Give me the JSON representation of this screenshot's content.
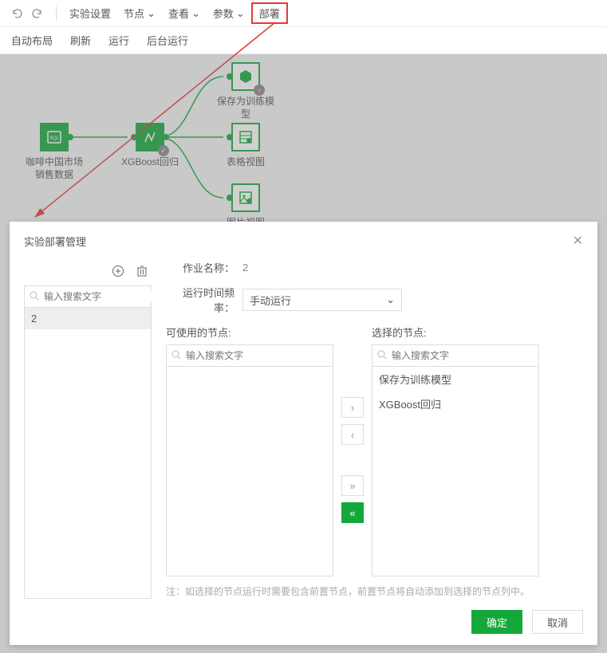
{
  "topbar": {
    "menu_exp_settings": "实验设置",
    "menu_nodes": "节点",
    "menu_view": "查看",
    "menu_params": "参数",
    "menu_deploy": "部署"
  },
  "subbar": {
    "auto_layout": "自动布局",
    "refresh": "刷新",
    "run": "运行",
    "run_bg": "后台运行"
  },
  "nodes": {
    "data_source": "咖啡中国市场销售数据",
    "model": "XGBoost回归",
    "save_model": "保存为训练模型",
    "table_view": "表格视图",
    "image_view": "图片视图"
  },
  "dialog": {
    "title": "实验部署管理",
    "job_name_label": "作业名称：",
    "job_name_value": "2",
    "freq_label": "运行时间频率：",
    "freq_value": "手动运行",
    "search_placeholder": "输入搜索文字",
    "left_list": [
      "2"
    ],
    "available_label": "可使用的节点:",
    "selected_label": "选择的节点:",
    "selected_items": [
      "保存为训练模型",
      "XGBoost回归"
    ],
    "note": "注：如选择的节点运行时需要包含前置节点，前置节点将自动添加到选择的节点列中。",
    "ok": "确定",
    "cancel": "取消"
  }
}
